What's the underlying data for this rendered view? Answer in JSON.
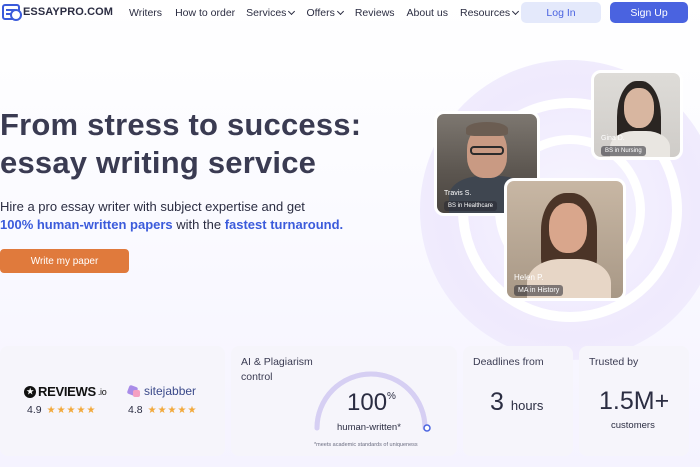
{
  "nav": {
    "logo_text": "ESSAYPRO.COM",
    "links": [
      {
        "label": "Writers",
        "dropdown": false
      },
      {
        "label": "How to order",
        "dropdown": false
      },
      {
        "label": "Services",
        "dropdown": true
      },
      {
        "label": "Offers",
        "dropdown": true
      },
      {
        "label": "Reviews",
        "dropdown": false
      },
      {
        "label": "About us",
        "dropdown": false
      },
      {
        "label": "Resources",
        "dropdown": true
      }
    ],
    "login_label": "Log In",
    "signup_label": "Sign Up"
  },
  "hero": {
    "title_line1": "From stress to success:",
    "title_line2": "essay writing service",
    "sub_line1": "Hire a pro essay writer with subject expertise and get",
    "sub_highlight1": "100% human-written papers",
    "sub_mid": " with the ",
    "sub_highlight2": "fastest turnaround",
    "sub_end": ".",
    "cta_label": "Write my paper"
  },
  "writers": [
    {
      "name": "Travis S.",
      "degree": "BS in Healthcare"
    },
    {
      "name": "Gina D.",
      "degree": "BS in Nursing"
    },
    {
      "name": "Helen P.",
      "degree": "MA in History"
    }
  ],
  "stats": {
    "reviews_io": {
      "brand": "REVIEWS",
      "suffix": ".io",
      "rating": "4.9",
      "stars": "★★★★★"
    },
    "sitejabber": {
      "brand": "sitejabber",
      "rating": "4.8",
      "stars": "★★★★★"
    },
    "ai": {
      "label_line1": "AI & Plagiarism",
      "label_line2": "control",
      "value": "100",
      "unit": "%",
      "caption": "human-written*",
      "footnote": "*meets academic standards of uniqueness",
      "level": 1.0
    },
    "deadlines": {
      "label": "Deadlines from",
      "value": "3",
      "unit": "hours"
    },
    "trusted": {
      "label": "Trusted by",
      "value": "1.5M+",
      "unit": "customers"
    }
  },
  "colors": {
    "accent": "#4a63e0",
    "cta": "#e07a3c",
    "stars": "#f2a93b"
  }
}
